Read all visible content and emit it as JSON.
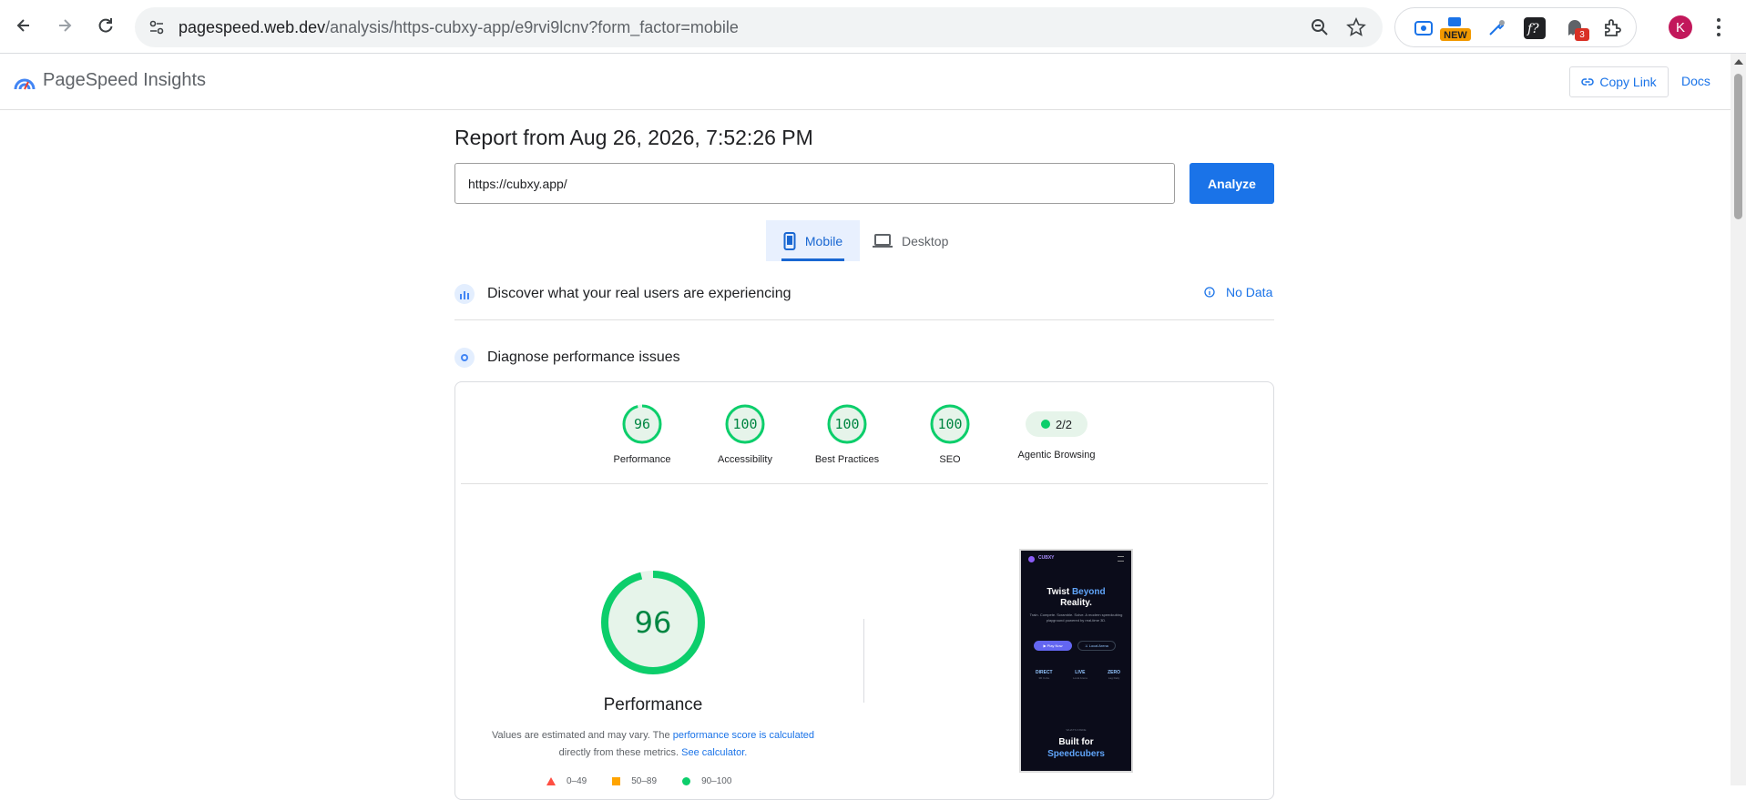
{
  "browser": {
    "url_host": "pagespeed.web.dev",
    "url_path": "/analysis/https-cubxy-app/e9rvi9lcnv?form_factor=mobile",
    "ext_badge_new": "NEW",
    "ext_badge_count": "3",
    "avatar_letter": "K"
  },
  "header": {
    "brand": "PageSpeed Insights",
    "copy_link": "Copy Link",
    "docs": "Docs"
  },
  "main": {
    "report_title": "Report from Aug 26, 2026, 7:52:26 PM",
    "url_value": "https://cubxy.app/",
    "analyze_label": "Analyze",
    "tabs": [
      {
        "label": "Mobile"
      },
      {
        "label": "Desktop"
      }
    ],
    "field_section": "Discover what your real users are experiencing",
    "no_data": "No Data",
    "diagnose_section": "Diagnose performance issues"
  },
  "scores": [
    {
      "value": 96,
      "label": "Performance"
    },
    {
      "value": 100,
      "label": "Accessibility"
    },
    {
      "value": 100,
      "label": "Best Practices"
    },
    {
      "value": 100,
      "label": "SEO"
    }
  ],
  "agentic": {
    "value": "2/2",
    "label": "Agentic Browsing"
  },
  "performance": {
    "score": "96",
    "title": "Performance",
    "note_prefix": "Values are estimated and may vary. The ",
    "note_link1": "performance score is calculated",
    "note_mid": "directly from these metrics. ",
    "note_link2": "See calculator.",
    "legend": [
      {
        "range": "0–49"
      },
      {
        "range": "50–89"
      },
      {
        "range": "90–100"
      }
    ]
  },
  "screenshot": {
    "brand": "CUBXY",
    "h1_a": "Twist ",
    "h1_b": "Beyond",
    "h1_c": "Reality.",
    "sub": "Train. Compete. Scramble. Solve. A modern speedcubing playground powered by real-time 3D.",
    "btn1": "▶ Play Now",
    "btn2": "⚔ Local Arena",
    "stats": [
      {
        "v": "DIRECT",
        "l": "3D Cube"
      },
      {
        "v": "LIVE",
        "l": "Local Arena"
      },
      {
        "v": "ZERO",
        "l": "Lag Daily"
      }
    ],
    "kicker": "WHAT'S INSIDE",
    "h2_a": "Built for",
    "h2_b": "Speedcubers"
  },
  "colors": {
    "accent": "#1a73e8",
    "pass": "#0cce6b",
    "average": "#ffa400",
    "fail": "#ff4e42"
  }
}
